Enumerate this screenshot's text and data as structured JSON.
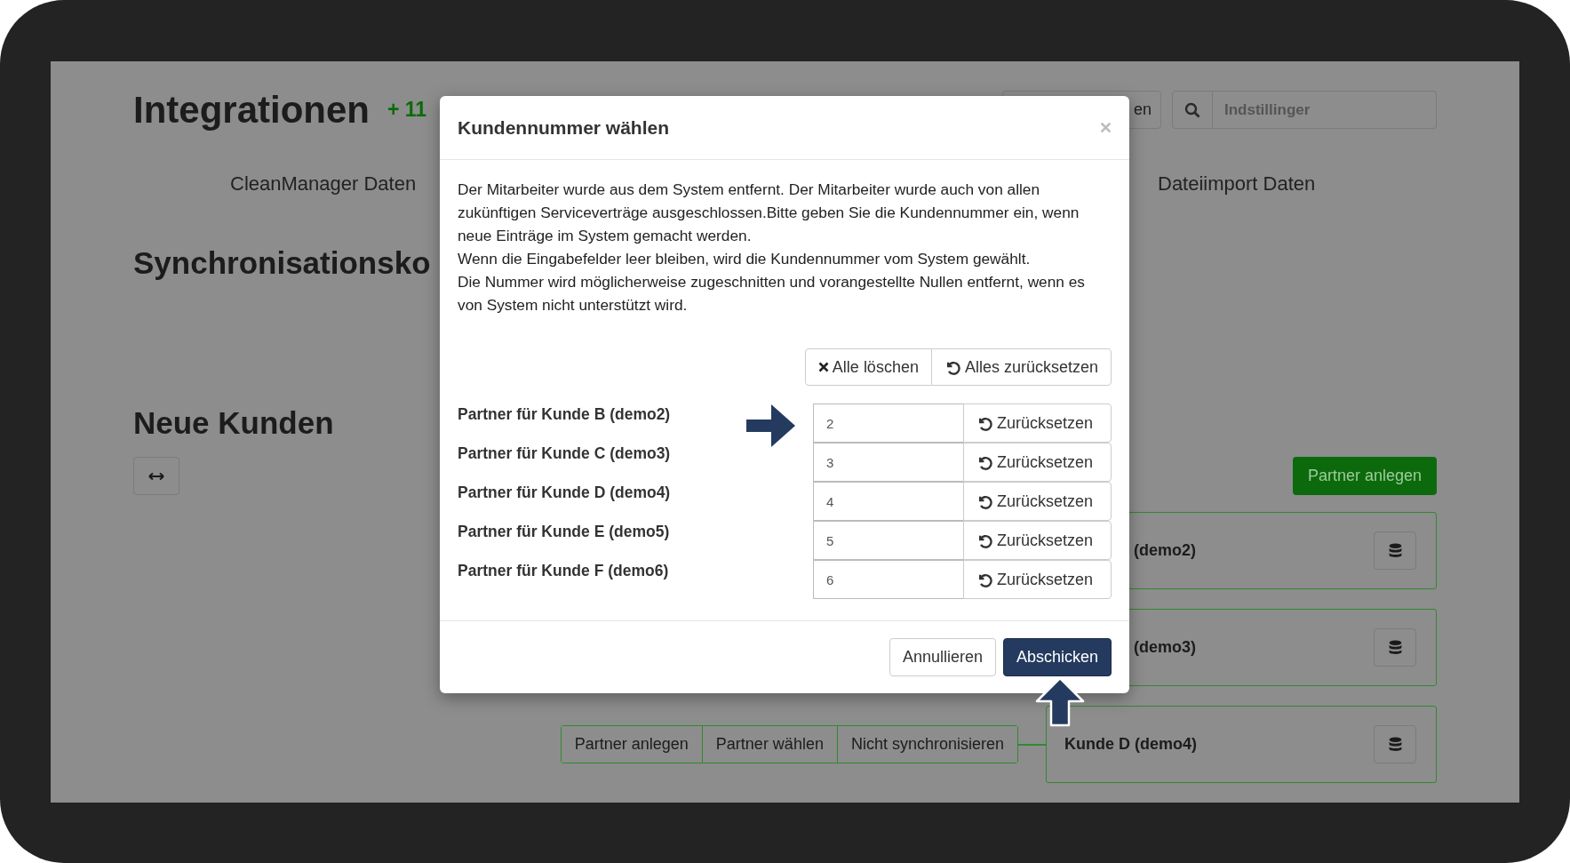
{
  "page": {
    "title": "Integrationen",
    "badge": "+ 11",
    "header_button": "en",
    "search": {
      "placeholder": "Indstillinger"
    },
    "tabs": [
      {
        "label": "CleanManager Daten"
      },
      {
        "label": "Dateiimport Daten"
      }
    ],
    "section_title": "Synchronisationsko",
    "new_customers": {
      "title": "Neue Kunden",
      "create_button": "Partner anlegen",
      "cards": [
        {
          "kind": "partial",
          "label": "(demo2)"
        },
        {
          "kind": "partial",
          "label": "(demo3)"
        },
        {
          "kind": "full",
          "label": "Kunde D (demo4)",
          "actions": [
            "Partner anlegen",
            "Partner wählen",
            "Nicht synchronisieren"
          ]
        }
      ]
    }
  },
  "dialog": {
    "title": "Kundennummer wählen",
    "message": [
      "Der Mitarbeiter wurde aus dem System entfernt. Der Mitarbeiter wurde auch von allen zukünftigen Serviceverträge ausgeschlossen.Bitte geben Sie die Kundennummer ein, wenn neue Einträge im System gemacht werden.",
      "Wenn die Eingabefelder leer bleiben, wird die Kundennummer vom System gewählt.",
      "Die Nummer wird möglicherweise zugeschnitten und vorangestellte Nullen entfernt, wenn es von System nicht unterstützt wird."
    ],
    "clear_all": "Alle löschen",
    "reset_all": "Alles zurücksetzen",
    "rows": [
      {
        "label": "Partner für Kunde B (demo2)",
        "value": "2",
        "reset": "Zurücksetzen"
      },
      {
        "label": "Partner für Kunde C (demo3)",
        "value": "3",
        "reset": "Zurücksetzen"
      },
      {
        "label": "Partner für Kunde D (demo4)",
        "value": "4",
        "reset": "Zurücksetzen"
      },
      {
        "label": "Partner für Kunde E (demo5)",
        "value": "5",
        "reset": "Zurücksetzen"
      },
      {
        "label": "Partner für Kunde F (demo6)",
        "value": "6",
        "reset": "Zurücksetzen"
      }
    ],
    "cancel": "Annullieren",
    "submit": "Abschicken"
  }
}
